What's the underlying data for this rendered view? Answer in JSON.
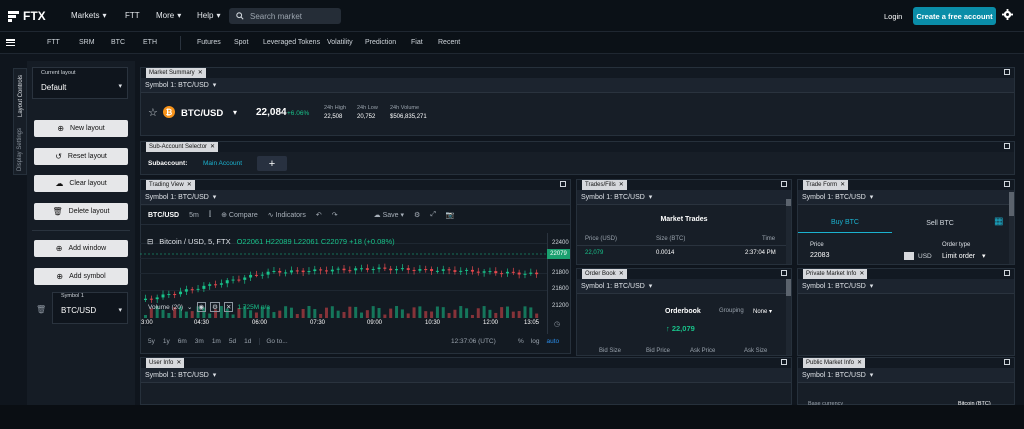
{
  "header": {
    "logo_text": "FTX",
    "nav": [
      {
        "label": "Markets",
        "has_dropdown": true
      },
      {
        "label": "FTT",
        "has_dropdown": false
      },
      {
        "label": "More",
        "has_dropdown": true
      },
      {
        "label": "Help",
        "has_dropdown": true
      }
    ],
    "search_placeholder": "Search market",
    "login_label": "Login",
    "create_account_label": "Create a free account"
  },
  "subnav": {
    "left_items": [
      "FTT",
      "SRM",
      "BTC",
      "ETH"
    ],
    "right_items": [
      "Futures",
      "Spot",
      "Leveraged Tokens",
      "Volatility",
      "Prediction",
      "Fiat",
      "Recent"
    ]
  },
  "left_rail": {
    "layout_controls_label": "Layout Controls",
    "display_settings_label": "Display Settings"
  },
  "layout_panel": {
    "current_layout_label": "Current layout",
    "current_layout_value": "Default",
    "buttons": [
      {
        "label": "New layout",
        "icon": "plus-circle-icon"
      },
      {
        "label": "Reset layout",
        "icon": "history-icon"
      },
      {
        "label": "Clear layout",
        "icon": "cloud-icon"
      },
      {
        "label": "Delete layout",
        "icon": "trash-icon"
      },
      {
        "label": "Add window",
        "icon": "plus-circle-icon"
      },
      {
        "label": "Add symbol",
        "icon": "plus-circle-icon"
      }
    ],
    "symbol_label": "Symbol 1",
    "symbol_value": "BTC/USD"
  },
  "market_summary": {
    "tab_label": "Market Summary",
    "symbol_label": "Symbol 1: BTC/USD",
    "pair": "BTC/USD",
    "price": "22,084",
    "change": "+6.06%",
    "stats": [
      {
        "label": "24h High",
        "value": "22,508"
      },
      {
        "label": "24h Low",
        "value": "20,752"
      },
      {
        "label": "24h Volume",
        "value": "$506,835,271"
      }
    ]
  },
  "subaccount": {
    "tab_label": "Sub-Account Selector",
    "label": "Subaccount:",
    "value": "Main Account",
    "add_label": "+"
  },
  "trading_view": {
    "tab_label": "Trading View",
    "symbol_label": "Symbol 1: BTC/USD",
    "toolbar": {
      "symbol": "BTC/USD",
      "interval": "5m",
      "compare": "Compare",
      "indicators": "Indicators",
      "save": "Save"
    },
    "legend": {
      "title": "Bitcoin / USD, 5, FTX",
      "ohlc": "O22061 H22089 L22061 C22079 +18 (+0.08%)",
      "volume": "Volume (20)",
      "volume_value": "1.725M n/a"
    },
    "price_ticks": [
      "22400",
      "22079",
      "21800",
      "21600",
      "21200"
    ],
    "time_ticks": [
      "3:00",
      "04:30",
      "06:00",
      "07:30",
      "09:00",
      "10:30",
      "12:00",
      "13:05"
    ],
    "range_buttons": [
      "5y",
      "1y",
      "6m",
      "3m",
      "1m",
      "5d",
      "1d"
    ],
    "goto_label": "Go to...",
    "clock": "12:37:06 (UTC)",
    "scale_buttons": [
      "%",
      "log",
      "auto"
    ],
    "last_price": "22079"
  },
  "trades": {
    "tab_label": "Trades/Fills",
    "symbol_label": "Symbol 1: BTC/USD",
    "title": "Market Trades",
    "columns": [
      "Price (USD)",
      "Size (BTC)",
      "Time"
    ],
    "rows": [
      {
        "price": "22,079",
        "size": "0.0014",
        "time": "2:37:04 PM"
      }
    ]
  },
  "orderbook": {
    "tab_label": "Order Book",
    "symbol_label": "Symbol 1: BTC/USD",
    "title": "Orderbook",
    "grouping_label": "Grouping",
    "grouping_value": "None",
    "mid_price": "22,079",
    "columns": [
      "Bid Size",
      "Bid Price",
      "Ask Price",
      "Ask Size"
    ]
  },
  "trade_form": {
    "tab_label": "Trade Form",
    "symbol_label": "Symbol 1: BTC/USD",
    "buy_label": "Buy BTC",
    "sell_label": "Sell BTC",
    "price_label": "Price",
    "price_value": "22083",
    "currency": "USD",
    "order_type_label": "Order type",
    "order_type_value": "Limit order"
  },
  "private_market_info": {
    "tab_label": "Private Market Info",
    "symbol_label": "Symbol 1: BTC/USD"
  },
  "user_info": {
    "tab_label": "User Info",
    "symbol_label": "Symbol 1: BTC/USD"
  },
  "public_market_info": {
    "tab_label": "Public Market Info",
    "symbol_label": "Symbol 1: BTC/USD",
    "row_label": "Base currency",
    "row_value": "Bitcoin (BTC)"
  },
  "colors": {
    "accent": "#0a8da8",
    "up": "#18c28a",
    "down": "#e5484d"
  }
}
